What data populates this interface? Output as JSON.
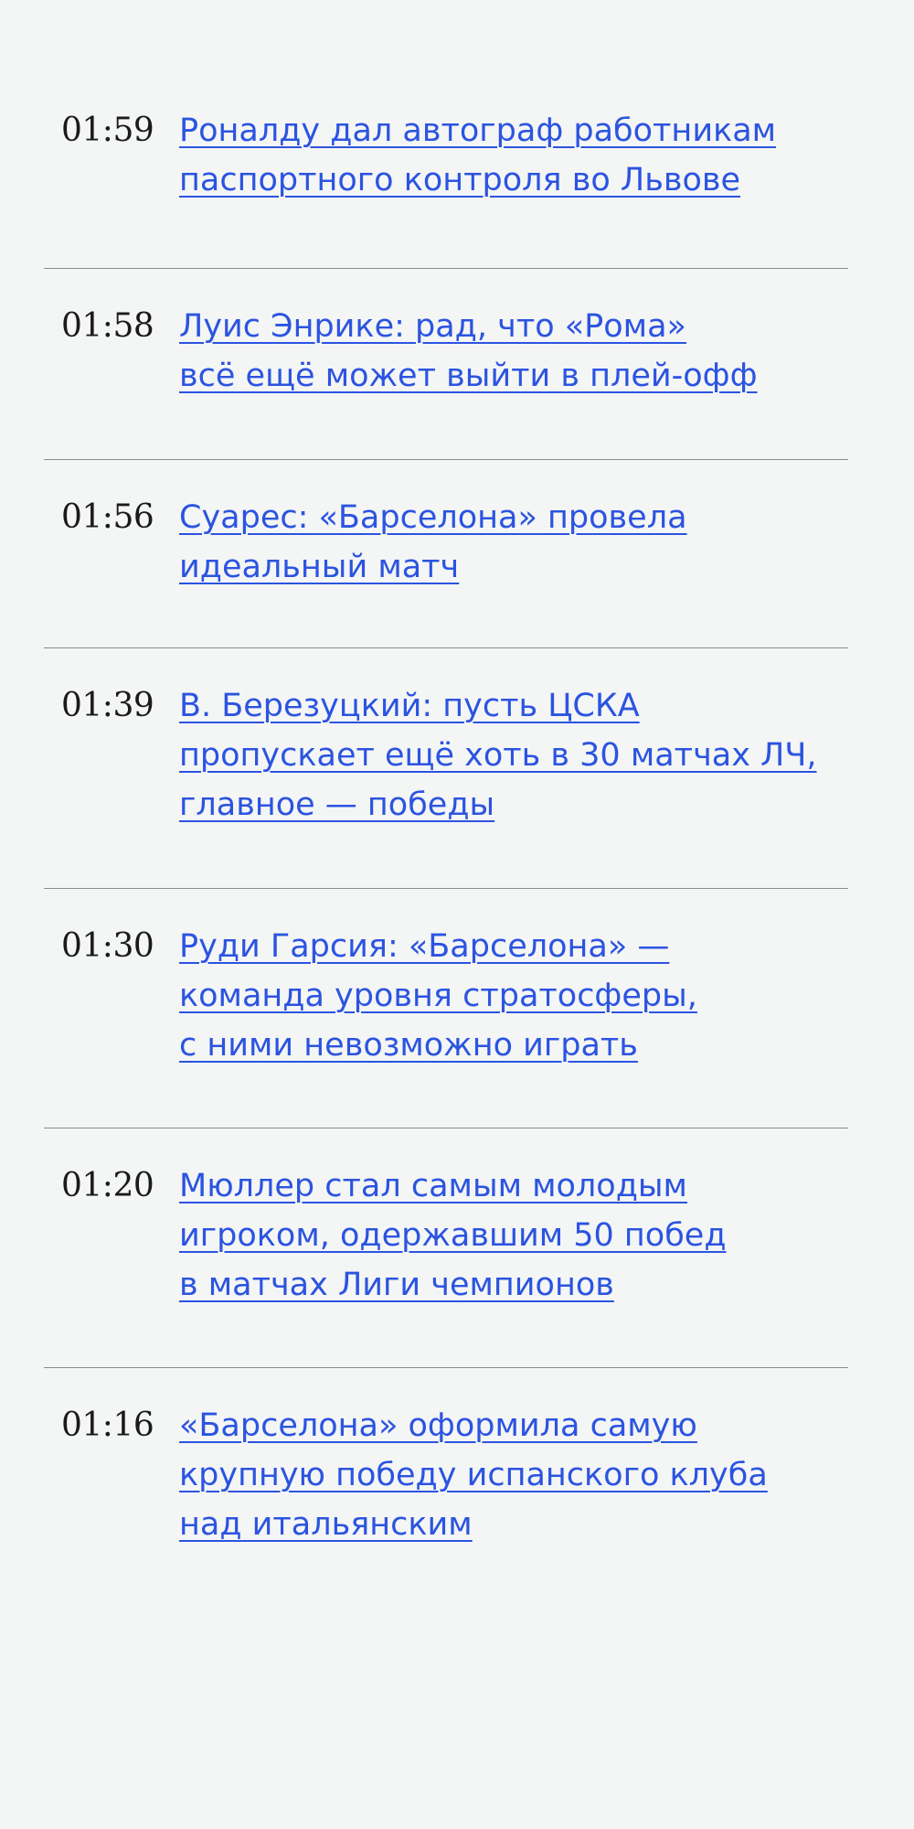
{
  "colors": {
    "background": "#f4f5f5",
    "link": "#2b54e0",
    "time": "#1a1a1a",
    "divider": "#8c8c8c"
  },
  "news": [
    {
      "time": "01:59",
      "title": "Роналду дал автограф работникам\nпаспортного контроля во Львове"
    },
    {
      "time": "01:58",
      "title": "Луис Энрике: рад, что «Рома»\nвсё ещё может выйти в плей-офф"
    },
    {
      "time": "01:56",
      "title": "Суарес: «Барселона» провела\nидеальный матч"
    },
    {
      "time": "01:39",
      "title": "В. Березуцкий: пусть ЦСКА\nпропускает ещё хоть в 30 матчах ЛЧ,\nглавное — победы"
    },
    {
      "time": "01:30",
      "title": "Руди Гарсия: «Барселона» —\nкоманда уровня стратосферы,\nс ними невозможно играть"
    },
    {
      "time": "01:20",
      "title": "Мюллер стал самым молодым\nигроком, одержавшим 50 побед\nв матчах Лиги чемпионов"
    },
    {
      "time": "01:16",
      "title": "«Барселона» оформила самую\nкрупную победу испанского клуба\nнад итальянским"
    }
  ]
}
